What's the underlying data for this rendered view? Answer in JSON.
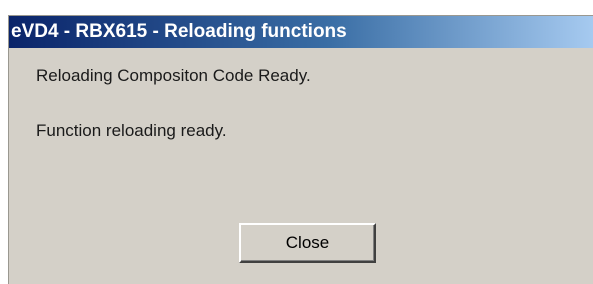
{
  "window": {
    "title": "eVD4 - RBX615 - Reloading functions"
  },
  "messages": {
    "line1": "Reloading Compositon Code Ready.",
    "line2": "Function reloading ready."
  },
  "buttons": {
    "close_label": "Close"
  }
}
